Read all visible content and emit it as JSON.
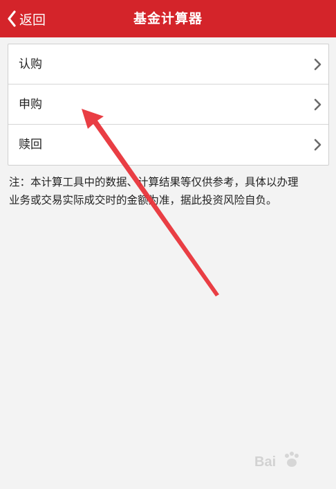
{
  "navbar": {
    "back_label": "返回",
    "title": "基金计算器",
    "background_color": "#d4242a"
  },
  "menu": {
    "items": [
      {
        "label": "认购",
        "icon": "chevron-right-icon"
      },
      {
        "label": "申购",
        "icon": "chevron-right-icon"
      },
      {
        "label": "赎回",
        "icon": "chevron-right-icon"
      }
    ]
  },
  "note": {
    "text": "注：本计算工具中的数据、计算结果等仅供参考，具体以办理\n业务或交易实际成交时的金额为准，据此投资风险自负。"
  },
  "annotation": {
    "type": "red-arrow",
    "color": "#e8343a"
  },
  "watermark": {
    "text": "Bai"
  }
}
